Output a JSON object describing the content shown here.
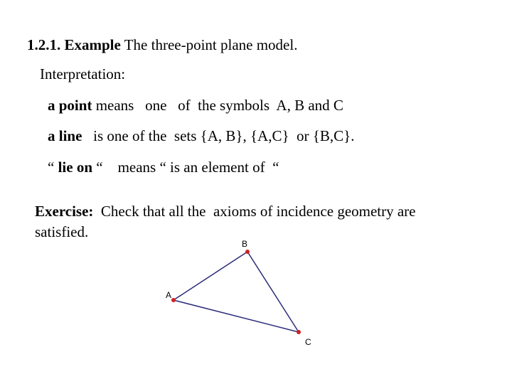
{
  "heading": {
    "number": "1.2.1. Example",
    "text": " The three-point plane model."
  },
  "interpretation_label": "Interpretation:",
  "definitions": [
    {
      "term": "a point",
      "text": " means   one   of  the symbols  A, B and C"
    },
    {
      "term": "a line",
      "text": "   is one of the  sets {A, B}, {A,C}  or {B,C}."
    },
    {
      "term_prefix": "“ ",
      "term": "lie on",
      "term_suffix": " “",
      "text": "    means “ is an element of  “"
    }
  ],
  "exercise": {
    "label": "Exercise:",
    "text_line1": "  Check that all the  axioms of incidence geometry are",
    "text_line2": "satisfied."
  },
  "figure": {
    "points": [
      {
        "label": "A"
      },
      {
        "label": "B"
      },
      {
        "label": "C"
      }
    ],
    "edges": [
      [
        "A",
        "B"
      ],
      [
        "B",
        "C"
      ],
      [
        "A",
        "C"
      ]
    ],
    "point_color": "#cc2222",
    "line_color": "#2b2b7a"
  }
}
